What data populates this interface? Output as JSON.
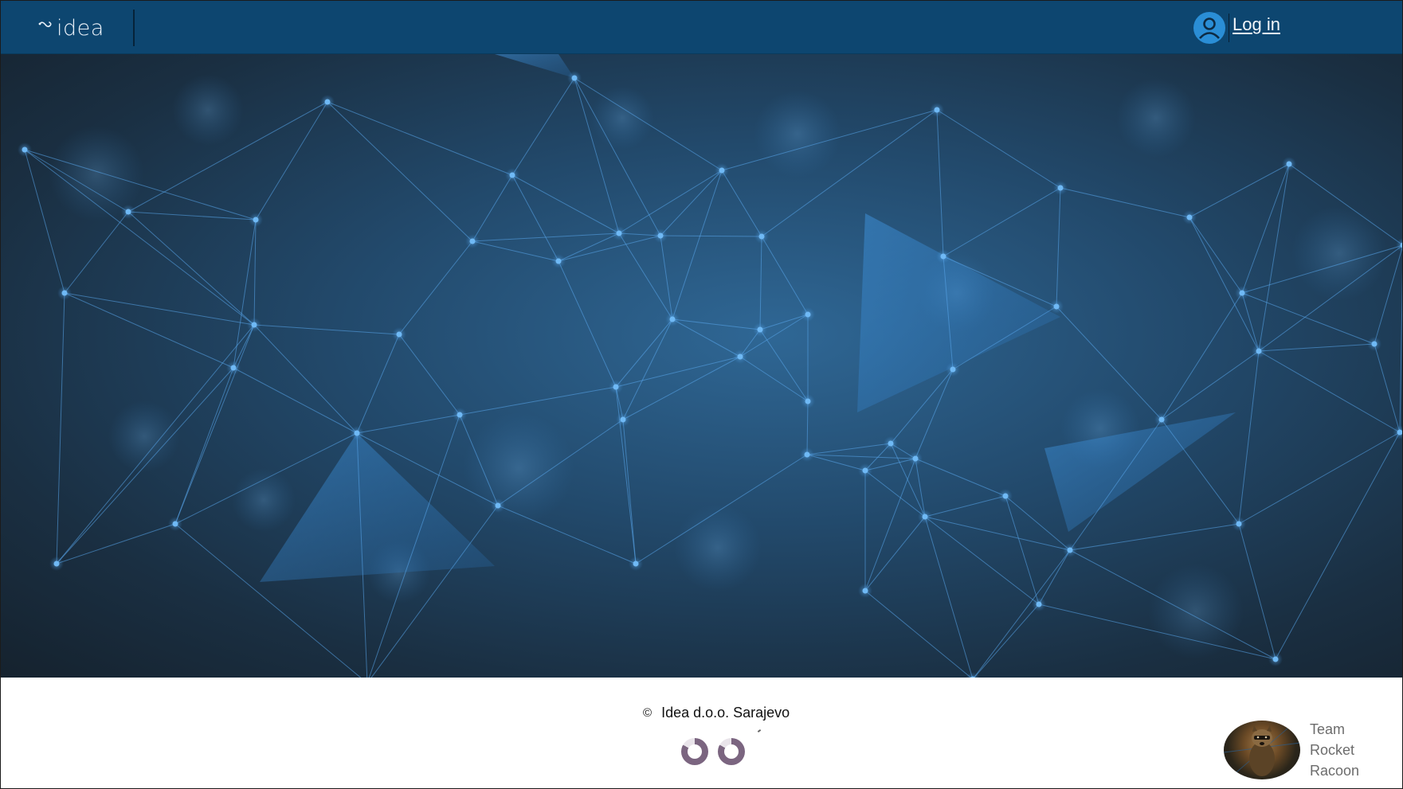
{
  "header": {
    "brand_label": "idea",
    "brand_icon": "idea-logo-icon",
    "login_label": "Log in",
    "login_icon": "user-avatar-icon",
    "background_color": "#0d4670"
  },
  "hero": {
    "image": "network-mesh-background",
    "accent_color": "#3b8fd9"
  },
  "footer": {
    "copyright_symbol": "©",
    "copyright_text": "Idea d.o.o. Sarajevo",
    "badges": [
      "badge-icon",
      "badge-icon"
    ],
    "team": {
      "line1": "Team",
      "line2": "Rocket",
      "line3": "Racoon",
      "avatar": "raccoon-avatar"
    }
  }
}
